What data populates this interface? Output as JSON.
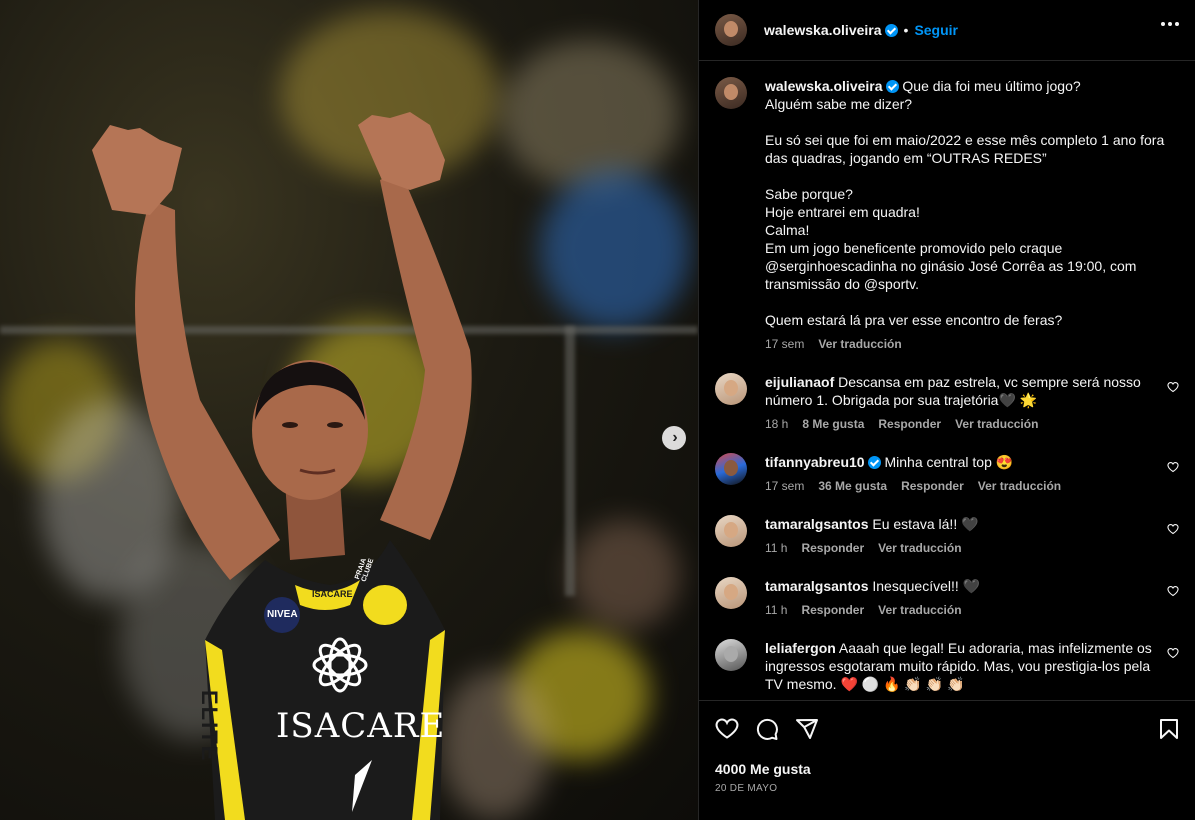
{
  "post": {
    "author": "walewska.oliveira",
    "follow_label": "Seguir",
    "dot": "•",
    "caption_paragraphs": [
      "Que dia foi meu último jogo?\nAlguém sabe me dizer?",
      "Eu só sei que foi em maio/2022 e esse mês completo 1 ano fora das quadras, jogando em “OUTRAS REDES”",
      "Sabe porque?\nHoje entrarei em quadra!\nCalma!\nEm um jogo beneficente promovido pelo craque @serginhoescadinha no ginásio José Corrêa as 19:00, com transmissão do @sportv.",
      "Quem estará lá pra ver esse encontro de feras?"
    ],
    "caption_time": "17 sem",
    "caption_translate": "Ver traducción",
    "likes": "4000 Me gusta",
    "date": "20 DE MAYO"
  },
  "media": {
    "jersey_brand": "ISACARE",
    "jersey_sponsor": "NIVEA",
    "jersey_sleeve_text": "ELITE",
    "jersey_badge": "PRAIA CLUBE",
    "jersey_chest_text": "ISACARE",
    "next_icon": "chevron-right-icon"
  },
  "comments": [
    {
      "user": "eijulianaof",
      "verified": false,
      "avatar": "light",
      "text": "Descansa em paz estrela, vc sempre será nosso número 1. Obrigada por sua trajetória🖤 🌟",
      "time": "18 h",
      "likes": "8 Me gusta",
      "reply": "Responder",
      "translate": "Ver traducción"
    },
    {
      "user": "tifannyabreu10",
      "verified": true,
      "avatar": "colorful",
      "text": "Minha central top 😍",
      "time": "17 sem",
      "likes": "36 Me gusta",
      "reply": "Responder",
      "translate": "Ver traducción"
    },
    {
      "user": "tamaralgsantos",
      "verified": false,
      "avatar": "light",
      "text": "Eu estava lá!! 🖤",
      "time": "11 h",
      "likes": "",
      "reply": "Responder",
      "translate": "Ver traducción"
    },
    {
      "user": "tamaralgsantos",
      "verified": false,
      "avatar": "light",
      "text": "Inesquecível!! 🖤",
      "time": "11 h",
      "likes": "",
      "reply": "Responder",
      "translate": "Ver traducción"
    },
    {
      "user": "leliafergon",
      "verified": false,
      "avatar": "bw",
      "text": "Aaaah que legal! Eu adoraria, mas infelizmente os ingressos esgotaram muito rápido. Mas, vou prestigia-los pela TV mesmo. ❤️ ⚪ 🔥 👏🏻 👏🏻 👏🏻",
      "time": "",
      "likes": "",
      "reply": "",
      "translate": ""
    }
  ],
  "icons": {
    "more": "more-options-icon",
    "like": "heart-icon",
    "comment": "comment-icon",
    "share": "share-icon",
    "save": "bookmark-icon"
  },
  "colors": {
    "accent": "#0095f6",
    "muted": "#a8a8a8",
    "jersey_yellow": "#f2dc1e"
  }
}
